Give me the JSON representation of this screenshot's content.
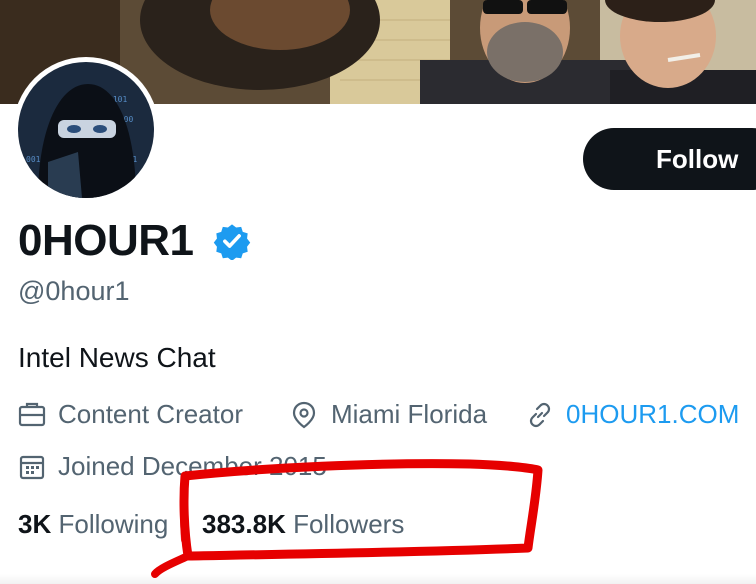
{
  "profile": {
    "display_name": "0HOUR1",
    "handle": "@0hour1",
    "bio": "Intel News Chat",
    "verified": true,
    "category": "Content Creator",
    "location": "Miami Florida",
    "website": "0HOUR1.COM",
    "joined": "Joined December 2015"
  },
  "actions": {
    "follow_label": "Follow"
  },
  "stats": {
    "following_count": "3K",
    "following_label": "Following",
    "followers_count": "383.8K",
    "followers_label": "Followers"
  },
  "icons": {
    "category": "briefcase-icon",
    "location": "location-pin-icon",
    "website": "link-icon",
    "joined": "calendar-icon",
    "verified": "verified-badge-icon"
  },
  "colors": {
    "accent": "#1d9bf0",
    "text_primary": "#0f1419",
    "text_secondary": "#536471",
    "follow_button_bg": "#0f1419",
    "annotation": "#e60000"
  }
}
